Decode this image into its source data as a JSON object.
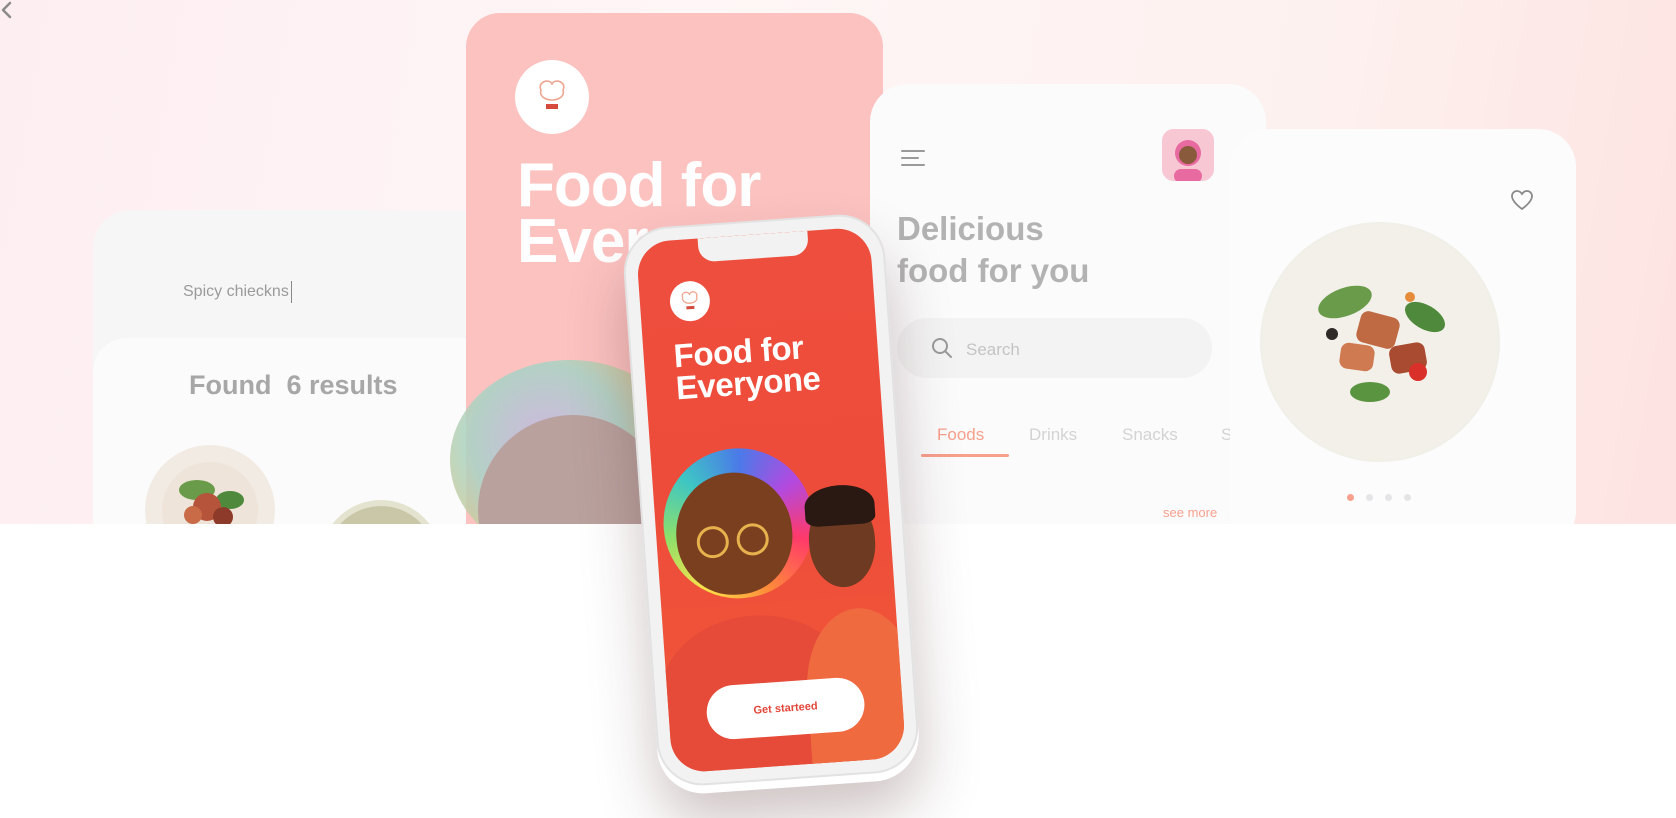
{
  "search_screen": {
    "query": "Spicy chieckns",
    "found_label": "Found",
    "found_count_text": "6 results"
  },
  "splash_screen": {
    "title_line1": "Food for",
    "title_line2": "Ever"
  },
  "phone": {
    "title_line1": "Food for",
    "title_line2": "Everyone",
    "cta_label": "Get starteed"
  },
  "home_screen": {
    "title_line1": "Delicious",
    "title_line2": "food for you",
    "search_placeholder": "Search",
    "tabs": [
      "Foods",
      "Drinks",
      "Snacks",
      "Sauc"
    ],
    "active_tab": "Foods",
    "see_more": "see more"
  },
  "detail_screen": {
    "carousel_pages": 4,
    "carousel_active_index": 0
  },
  "colors": {
    "brand_red": "#ee4e3e",
    "accent_salmon": "#f7a08c",
    "splash_pink": "#fbc2c0"
  },
  "icons": [
    "back-arrow-icon",
    "chef-logo-icon",
    "menu-icon",
    "search-icon",
    "heart-icon"
  ]
}
